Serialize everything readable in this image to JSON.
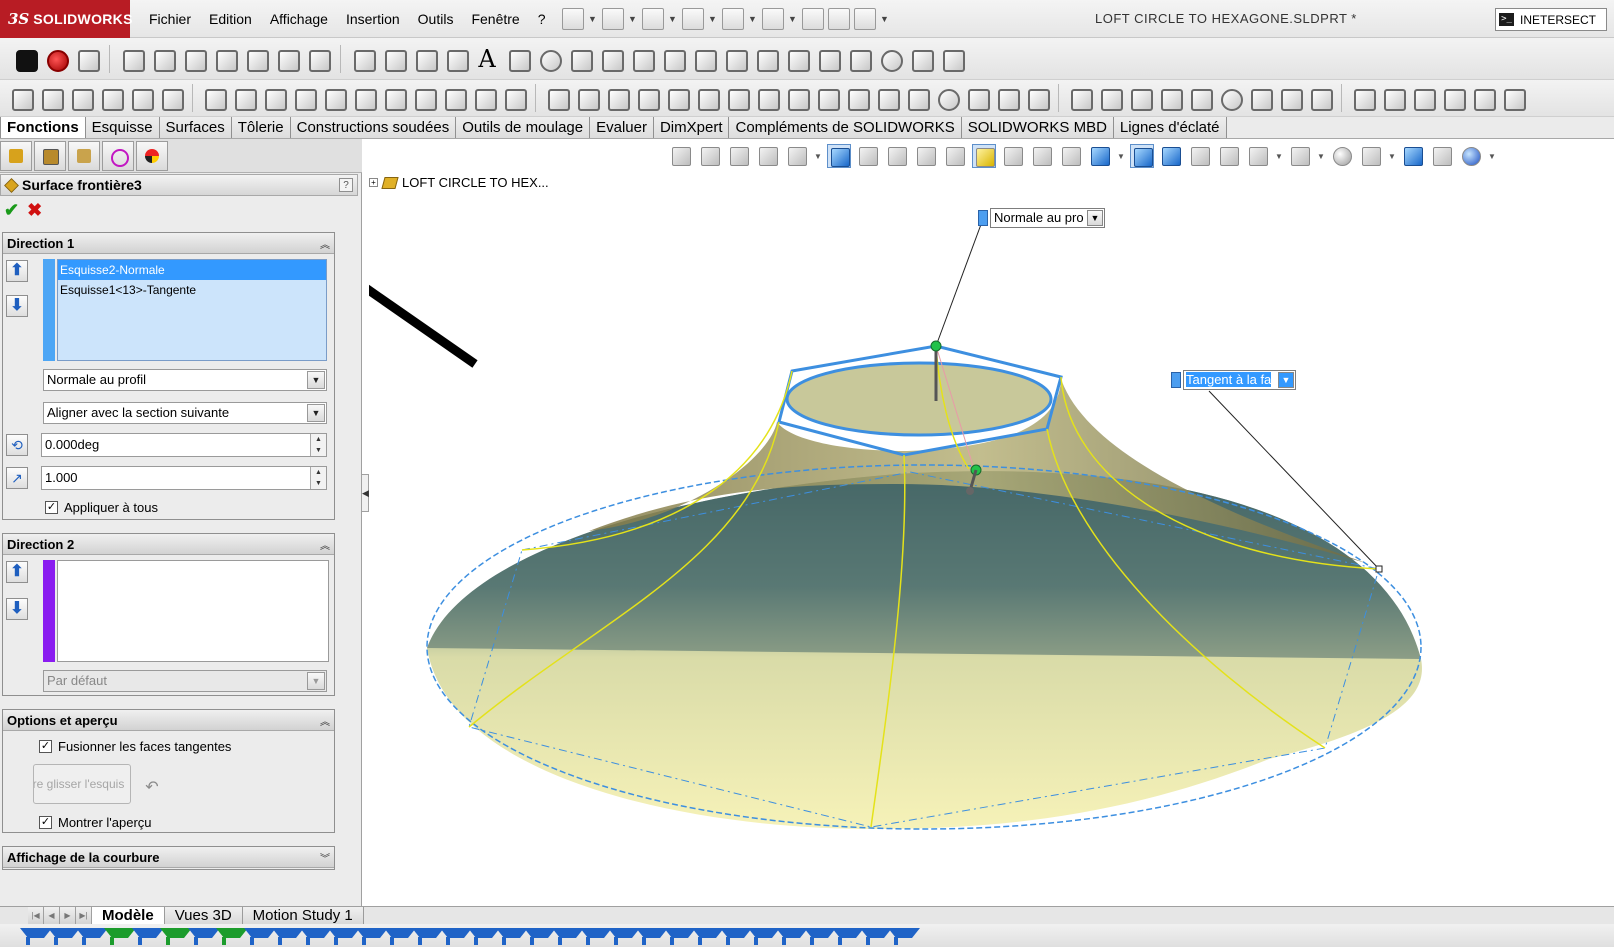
{
  "app": {
    "logo_prefix": "3S",
    "logo_name": "SOLIDWORKS",
    "document_title": "LOFT CIRCLE TO HEXAGONE.SLDPRT *",
    "command_search": "INETERSECT"
  },
  "menu": {
    "items": [
      "Fichier",
      "Edition",
      "Affichage",
      "Insertion",
      "Outils",
      "Fenêtre",
      "?"
    ]
  },
  "command_tabs": {
    "items": [
      "Fonctions",
      "Esquisse",
      "Surfaces",
      "Tôlerie",
      "Constructions soudées",
      "Outils de moulage",
      "Evaluer",
      "DimXpert",
      "Compléments de SOLIDWORKS",
      "SOLIDWORKS MBD",
      "Lignes d'éclaté"
    ]
  },
  "feature": {
    "title": "Surface frontière3",
    "help": "?",
    "ok_symbol": "✔",
    "cancel_symbol": "✖"
  },
  "direction1": {
    "label": "Direction 1",
    "curves": [
      "Esquisse2-Normale",
      "Esquisse1<13>-Tangente"
    ],
    "selected_index": 0,
    "tangent_type": "Normale au profil",
    "alignment": "Aligner avec la section suivante",
    "angle": "0.000deg",
    "influence": "1.000",
    "apply_all_label": "Appliquer à tous",
    "apply_all_checked": true,
    "color": "#4da6f5"
  },
  "direction2": {
    "label": "Direction 2",
    "curves": [],
    "default_option": "Par défaut",
    "color": "#8a1cf0"
  },
  "options": {
    "label": "Options et aperçu",
    "merge_tangent_label": "Fusionner les faces tangentes",
    "merge_tangent_checked": true,
    "drag_sketch_label": "ire glisser l'esquis",
    "show_preview_label": "Montrer l'aperçu",
    "show_preview_checked": true
  },
  "curvature": {
    "label": "Affichage de la courbure"
  },
  "tree": {
    "root": "LOFT CIRCLE TO HEX..."
  },
  "callouts": {
    "top": "Normale au pro",
    "right": "Tangent à la fa"
  },
  "bottom_tabs": {
    "items": [
      "Modèle",
      "Vues 3D",
      "Motion Study 1"
    ]
  },
  "icons": {
    "collapse": "chevron-double-up-icon",
    "expand": "chevron-double-down-icon",
    "dropdown": "▼",
    "arrow_up": "⬆",
    "arrow_down": "⬇"
  },
  "colors": {
    "logo_red": "#b81c24",
    "selection_blue": "#3399ff",
    "surface_yellow": "#f6f2b0",
    "surface_teal": "#4d6e6e",
    "edge_blue": "#3d8fe0",
    "boundary_yellow": "#e4e21a"
  }
}
